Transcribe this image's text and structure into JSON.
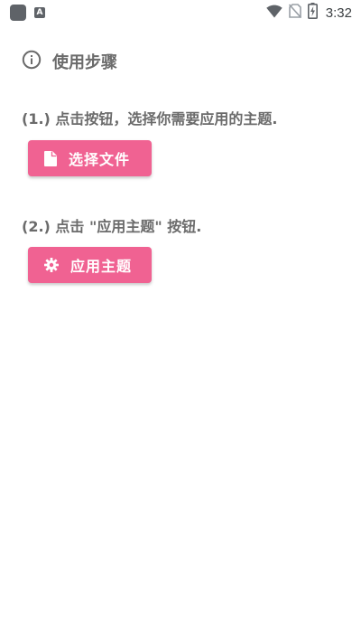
{
  "status_bar": {
    "time": "3:32",
    "icons": [
      "notification-square-icon",
      "font-a-icon",
      "wifi-icon",
      "no-sim-icon",
      "battery-charging-icon"
    ],
    "notif_letter": "A"
  },
  "instructions": {
    "header_icon": "info-icon",
    "title": "使用步骤",
    "step1": "(1.) 点击按钮，选择你需要应用的主题.",
    "select_button": {
      "icon": "file-icon",
      "label": "选择文件"
    },
    "step2": "(2.) 点击 \"应用主题\" 按钮.",
    "apply_button": {
      "icon": "gear-icon",
      "label": "应用主题"
    }
  },
  "colors": {
    "accent": "#f06292",
    "text_gray": "#6b6b6b",
    "status_icon": "#5f6368"
  }
}
